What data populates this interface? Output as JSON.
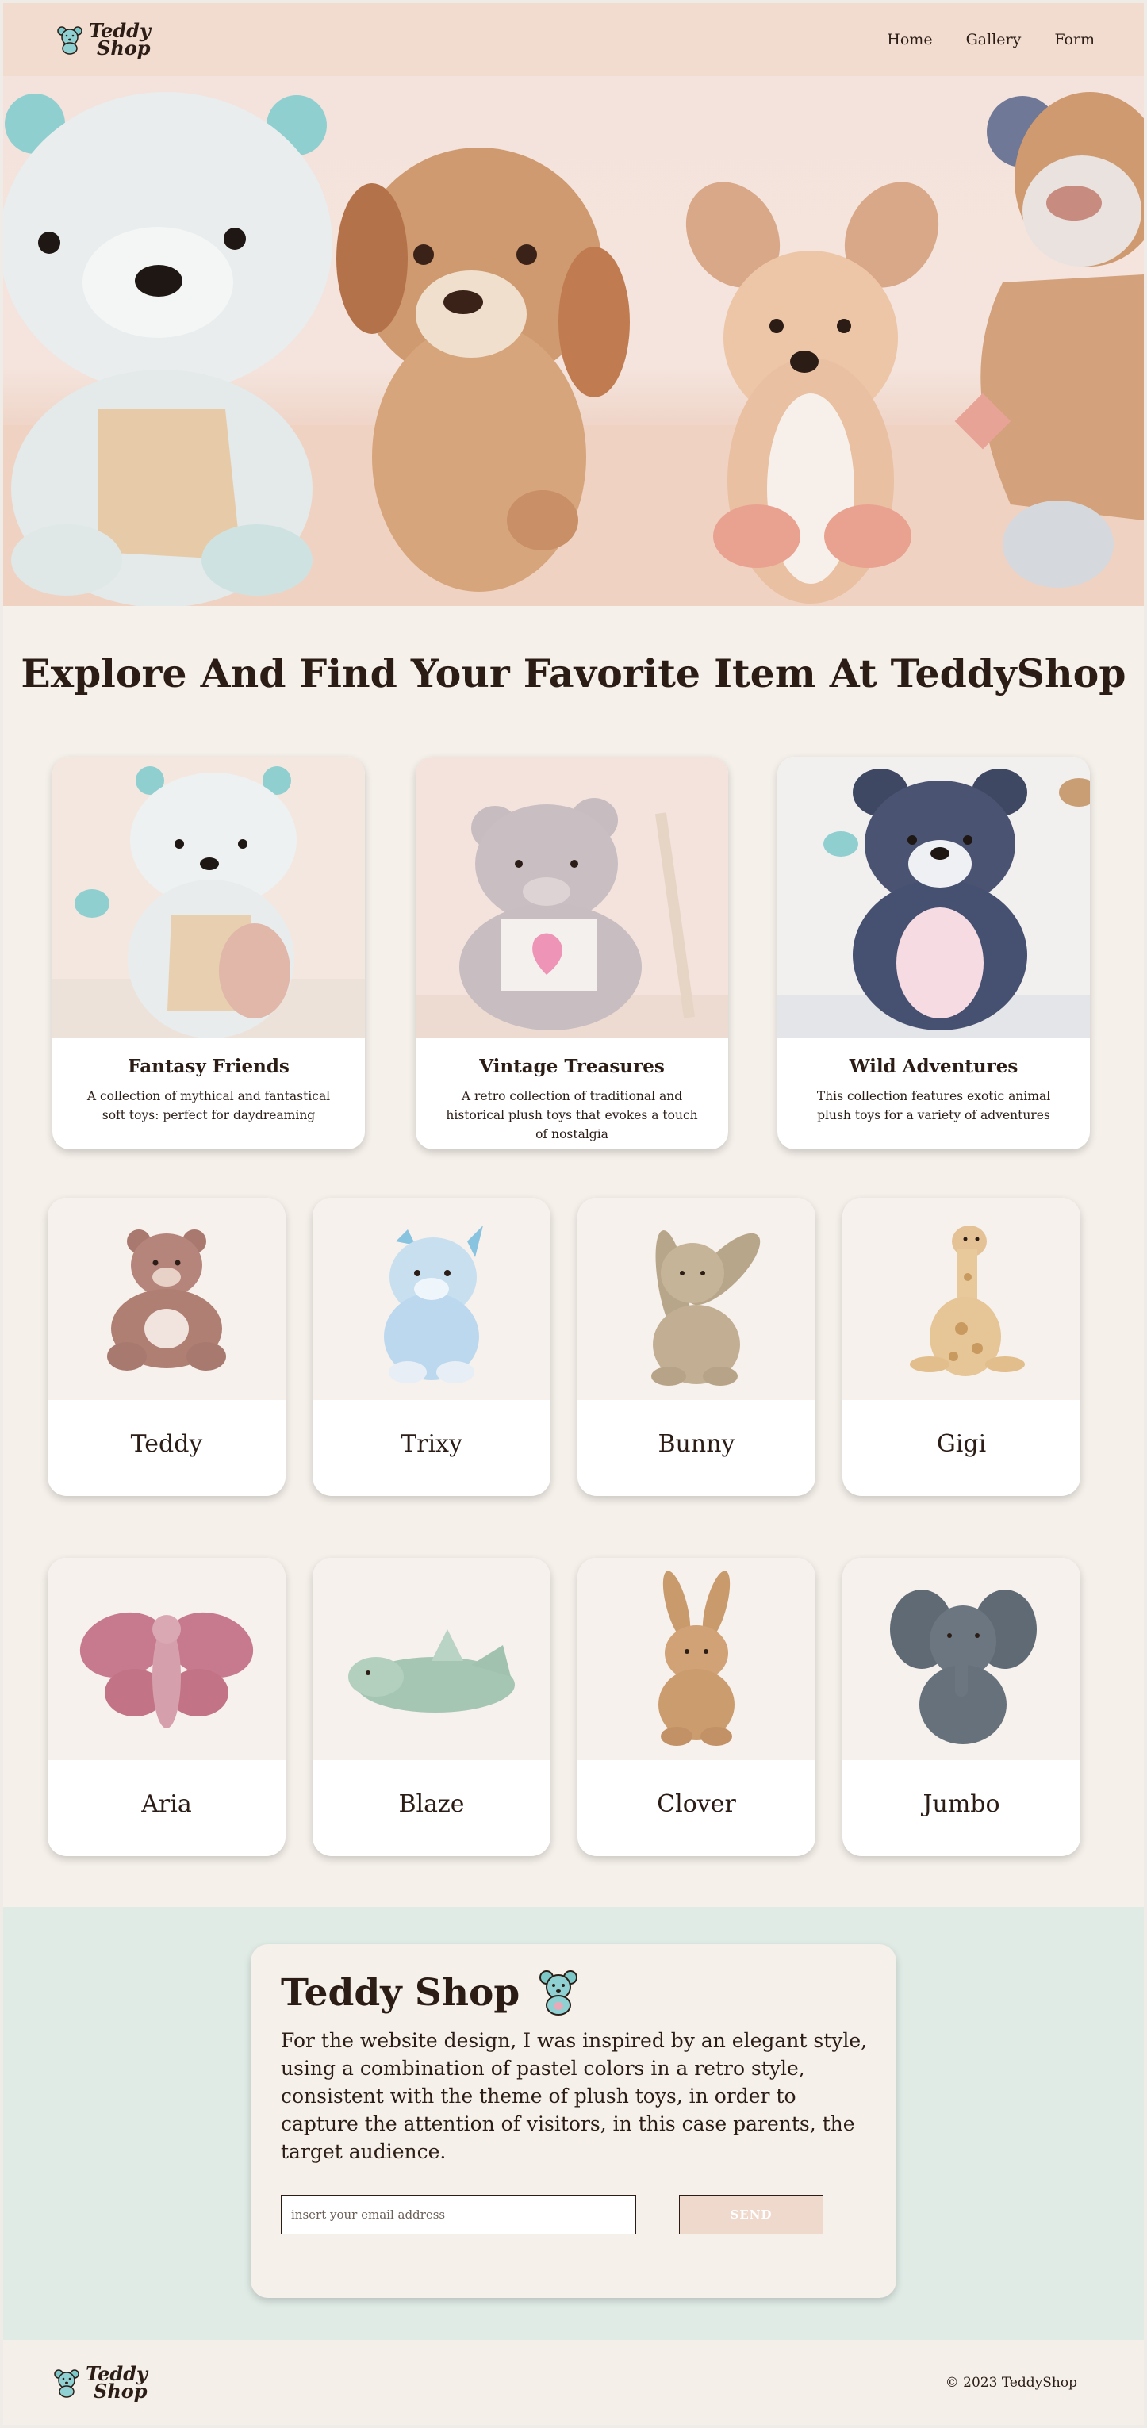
{
  "header": {
    "logo": {
      "line1": "Teddy",
      "line2": "Shop",
      "icon": "teddy-bear-icon"
    },
    "nav": [
      {
        "label": "Home"
      },
      {
        "label": "Gallery"
      },
      {
        "label": "Form"
      }
    ]
  },
  "main": {
    "title": "Explore And Find Your Favorite Item At TeddyShop",
    "featured": [
      {
        "title": "Fantasy Friends",
        "description": "A collection of mythical and fantastical soft toys: perfect for daydreaming"
      },
      {
        "title": "Vintage Treasures",
        "description": "A retro collection of traditional and historical plush toys that evokes a touch of nostalgia"
      },
      {
        "title": "Wild Adventures",
        "description": "This collection features exotic animal plush toys for a variety of adventures"
      }
    ],
    "products": [
      {
        "name": "Teddy"
      },
      {
        "name": "Trixy"
      },
      {
        "name": "Bunny"
      },
      {
        "name": "Gigi"
      },
      {
        "name": "Aria"
      },
      {
        "name": "Blaze"
      },
      {
        "name": "Clover"
      },
      {
        "name": "Jumbo"
      }
    ]
  },
  "newsletter": {
    "title": "Teddy Shop",
    "text": "For the website design, I was inspired by an elegant style, using a combination of pastel colors in a retro style, consistent with the theme of plush toys, in order to capture the attention of visitors, in this case parents, the target audience.",
    "email_placeholder": "insert your email address",
    "send_label": "SEND"
  },
  "footer": {
    "logo": {
      "line1": "Teddy",
      "line2": "Shop"
    },
    "copyright": "© 2023 TeddyShop"
  },
  "colors": {
    "header_bg": "#f2dccf",
    "page_bg": "#f5f0ea",
    "newsletter_bg": "#e0ebe6",
    "button_bg": "#efd8cc",
    "text": "#2b1d16"
  }
}
